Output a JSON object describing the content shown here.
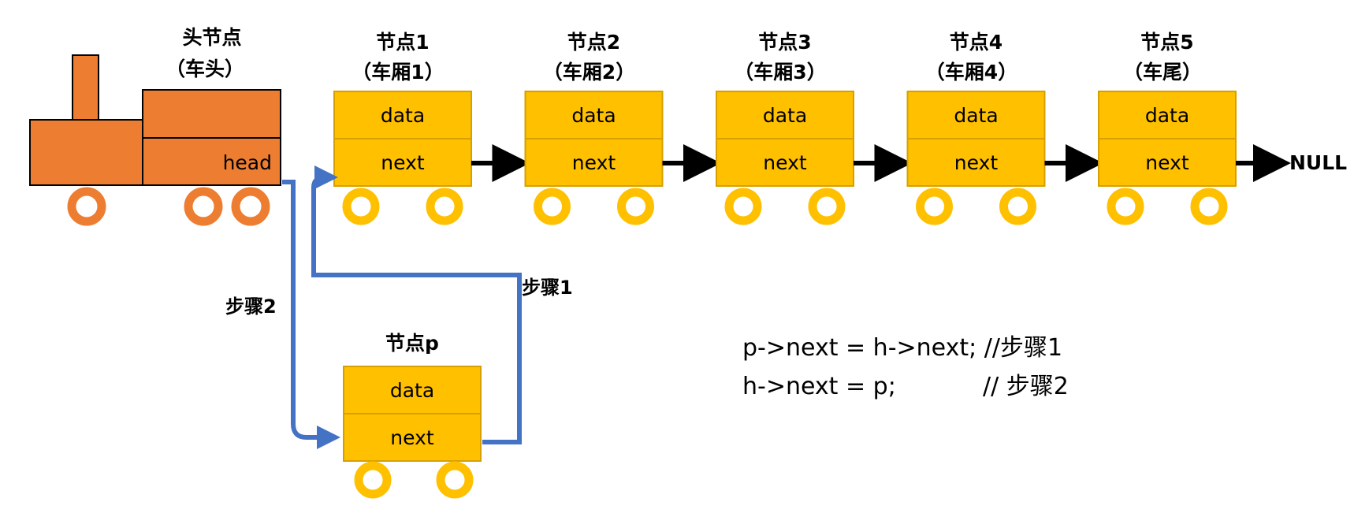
{
  "head_node": {
    "title_line1": "头节点",
    "title_line2": "（车头）",
    "field": "head",
    "color": "#ED7D31"
  },
  "nodes": [
    {
      "title_line1": "节点1",
      "title_line2": "（车厢1）",
      "data": "data",
      "next": "next"
    },
    {
      "title_line1": "节点2",
      "title_line2": "（车厢2）",
      "data": "data",
      "next": "next"
    },
    {
      "title_line1": "节点3",
      "title_line2": "（车厢3）",
      "data": "data",
      "next": "next"
    },
    {
      "title_line1": "节点4",
      "title_line2": "（车厢4）",
      "data": "data",
      "next": "next"
    },
    {
      "title_line1": "节点5",
      "title_line2": "（车尾）",
      "data": "data",
      "next": "next"
    }
  ],
  "null_label": "NULL",
  "new_node": {
    "title": "节点p",
    "data": "data",
    "next": "next"
  },
  "steps": {
    "step1": "步骤1",
    "step2": "步骤2"
  },
  "code": {
    "line1": "p->next = h->next; //步骤1",
    "line2_stmt": "h->next = p;",
    "line2_comment": "// 步骤2"
  },
  "colors": {
    "node_fill": "#FFC000",
    "node_border": "#D6A000",
    "wheel_fill": "#FFC000",
    "head_fill": "#ED7D31",
    "arrow": "#000000",
    "step_arrow": "#4472C4"
  }
}
